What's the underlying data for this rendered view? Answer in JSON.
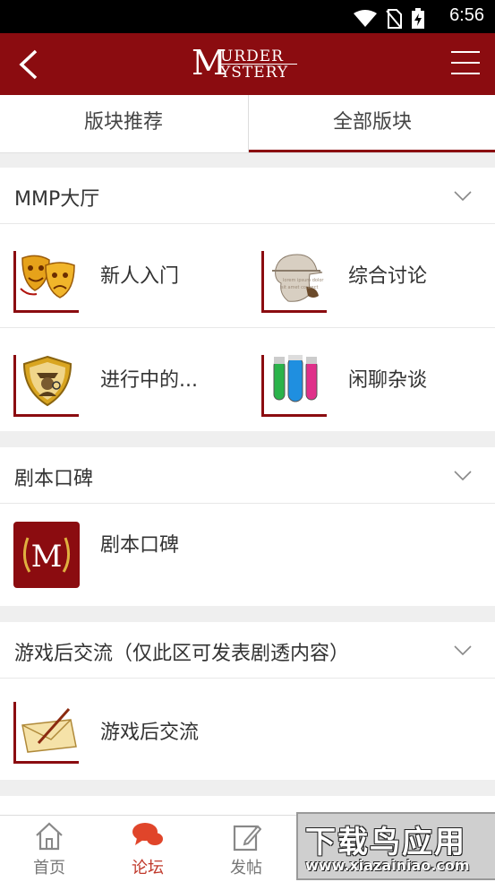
{
  "status_bar": {
    "time": "6:56"
  },
  "header": {
    "logo_text_m": "M",
    "logo_line1": "URDER",
    "logo_line2": "YSTERY"
  },
  "tabs": [
    {
      "label": "版块推荐",
      "active": false
    },
    {
      "label": "全部版块",
      "active": true
    }
  ],
  "sections": [
    {
      "title": "MMP大厅",
      "items": [
        {
          "label": "新人入门",
          "icon": "theater-masks-icon"
        },
        {
          "label": "综合讨论",
          "icon": "detective-head-icon"
        },
        {
          "label": "进行中的...",
          "icon": "detective-badge-icon"
        },
        {
          "label": "闲聊杂谈",
          "icon": "test-tubes-icon"
        }
      ]
    },
    {
      "title": "剧本口碑",
      "items": [
        {
          "label": "剧本口碑",
          "icon": "laurel-m-logo-icon"
        }
      ]
    },
    {
      "title": "游戏后交流（仅此区可发表剧透内容）",
      "items": [
        {
          "label": "游戏后交流",
          "icon": "envelope-pen-icon"
        }
      ]
    }
  ],
  "bottom_nav": [
    {
      "label": "首页",
      "icon": "home-icon",
      "active": false
    },
    {
      "label": "论坛",
      "icon": "chat-bubbles-icon",
      "active": true
    },
    {
      "label": "发帖",
      "icon": "edit-icon",
      "active": false
    }
  ],
  "watermark": {
    "line1": "下载鸟应用",
    "line2": "www.xiazainiao.com"
  },
  "colors": {
    "brand": "#8b0c10",
    "active_nav": "#c0392b"
  }
}
